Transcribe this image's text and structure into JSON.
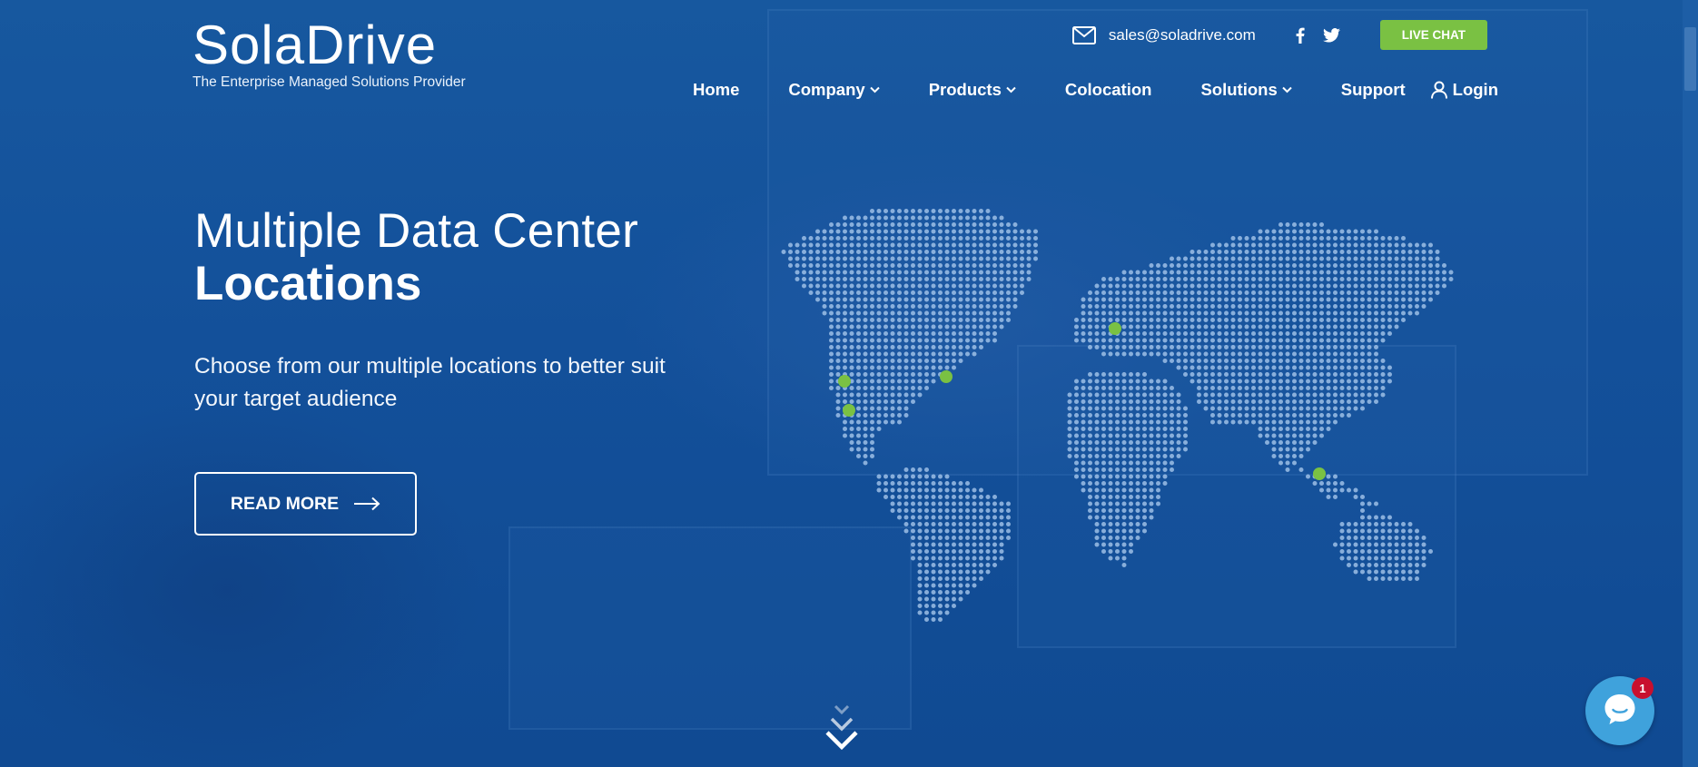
{
  "brand": {
    "logo_text": "SolaDrive",
    "tagline": "The Enterprise Managed Solutions Provider"
  },
  "topbar": {
    "email": "sales@soladrive.com",
    "email_icon": "envelope-icon",
    "social": [
      "facebook-icon",
      "twitter-icon"
    ],
    "live_chat_label": "LIVE CHAT"
  },
  "nav": {
    "home": "Home",
    "company": "Company",
    "products": "Products",
    "colocation": "Colocation",
    "solutions": "Solutions",
    "support": "Support",
    "login": "Login"
  },
  "hero": {
    "title_line1": "Multiple Data Center",
    "title_line2": "Locations",
    "subtitle": "Choose from our multiple locations to better suit your target audience",
    "cta_label": "READ MORE"
  },
  "chat": {
    "badge_count": "1"
  },
  "colors": {
    "background": "#13509a",
    "accent_green": "#7ac143",
    "chat_blue": "#3fa2dc",
    "badge_red": "#c8102e"
  }
}
